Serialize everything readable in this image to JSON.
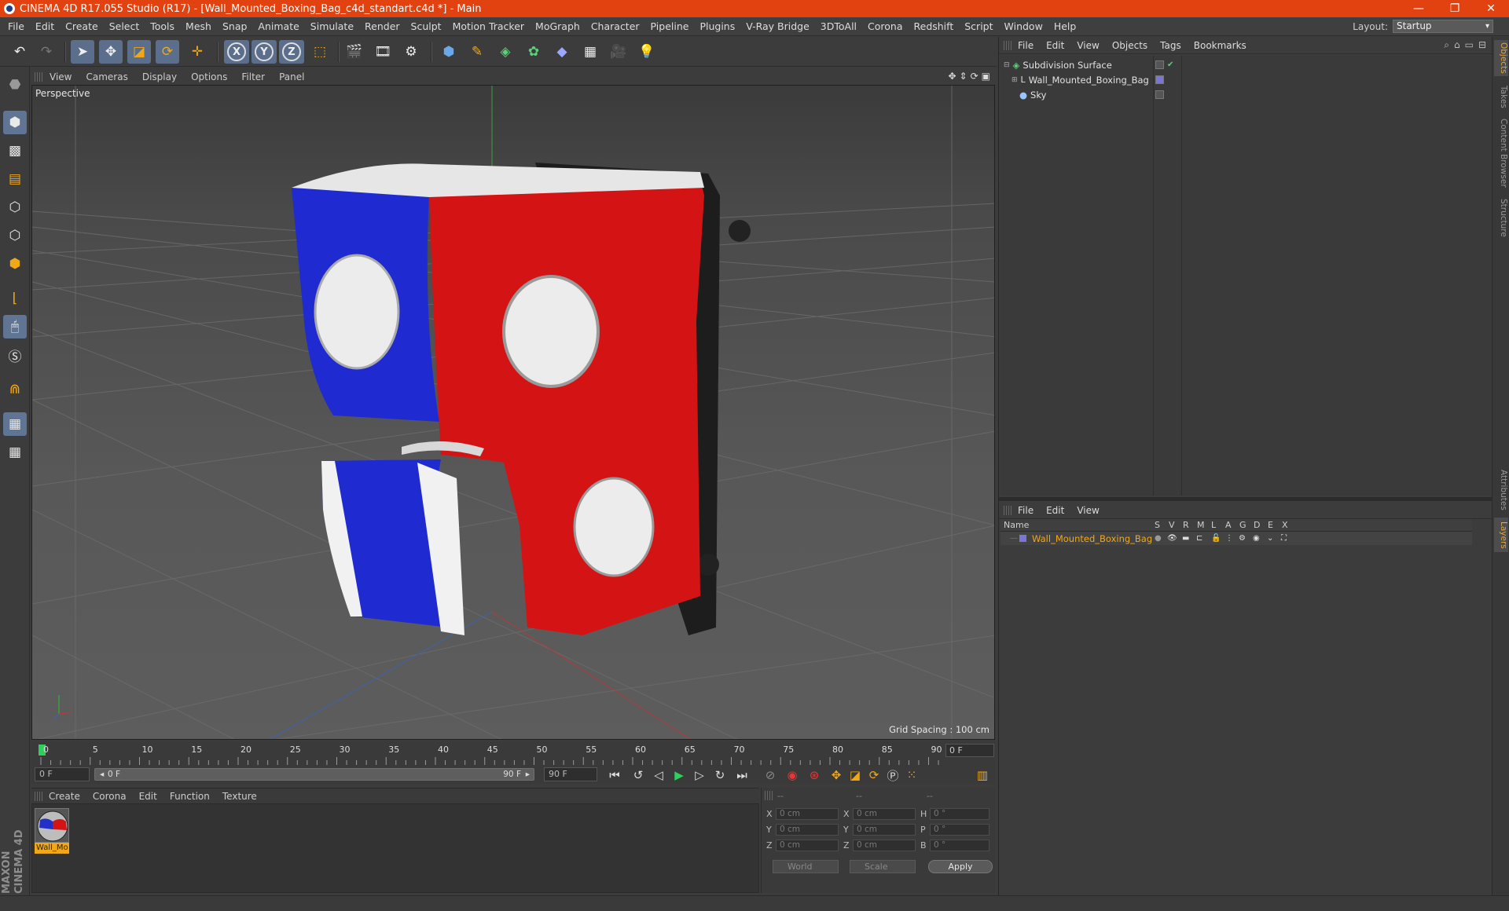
{
  "titlebar": {
    "title": "CINEMA 4D R17.055 Studio (R17) - [Wall_Mounted_Boxing_Bag_c4d_standart.c4d *] - Main"
  },
  "menubar": {
    "items": [
      "File",
      "Edit",
      "Create",
      "Select",
      "Tools",
      "Mesh",
      "Snap",
      "Animate",
      "Simulate",
      "Render",
      "Sculpt",
      "Motion Tracker",
      "MoGraph",
      "Character",
      "Pipeline",
      "Plugins",
      "V-Ray Bridge",
      "3DToAll",
      "Corona",
      "Redshift",
      "Script",
      "Window",
      "Help"
    ],
    "layout_label": "Layout:",
    "layout_value": "Startup"
  },
  "toolbar": {
    "x_label": "X",
    "y_label": "Y",
    "z_label": "Z"
  },
  "viewport": {
    "menu": [
      "View",
      "Cameras",
      "Display",
      "Options",
      "Filter",
      "Panel"
    ],
    "label": "Perspective",
    "grid_spacing": "Grid Spacing : 100 cm"
  },
  "timeline": {
    "ticks": [
      "0",
      "5",
      "10",
      "15",
      "20",
      "25",
      "30",
      "35",
      "40",
      "45",
      "50",
      "55",
      "60",
      "65",
      "70",
      "75",
      "80",
      "85",
      "90"
    ],
    "current_frame": "0 F",
    "start_frame": "0 F",
    "slider_start": "0 F",
    "slider_end": "90 F",
    "end_frame": "90 F"
  },
  "materials": {
    "menu": [
      "Create",
      "Corona",
      "Edit",
      "Function",
      "Texture"
    ],
    "items": [
      {
        "label": "Wall_Mo"
      }
    ]
  },
  "coords": {
    "header": [
      "--",
      "--",
      "--"
    ],
    "rows": [
      {
        "l1": "X",
        "v1": "0 cm",
        "l2": "X",
        "v2": "0 cm",
        "l3": "H",
        "v3": "0 °"
      },
      {
        "l1": "Y",
        "v1": "0 cm",
        "l2": "Y",
        "v2": "0 cm",
        "l3": "P",
        "v3": "0 °"
      },
      {
        "l1": "Z",
        "v1": "0 cm",
        "l2": "Z",
        "v2": "0 cm",
        "l3": "B",
        "v3": "0 °"
      }
    ],
    "mode": "World",
    "type": "Scale",
    "apply": "Apply"
  },
  "objects_panel": {
    "menu": [
      "File",
      "Edit",
      "View",
      "Objects",
      "Tags",
      "Bookmarks"
    ],
    "items": [
      {
        "name": "Subdivision Surface"
      },
      {
        "name": "Wall_Mounted_Boxing_Bag"
      },
      {
        "name": "Sky"
      }
    ]
  },
  "layers_panel": {
    "menu": [
      "File",
      "Edit",
      "View"
    ],
    "columns": [
      "Name",
      "S",
      "V",
      "R",
      "M",
      "L",
      "A",
      "G",
      "D",
      "E",
      "X"
    ],
    "rows": [
      {
        "name": "Wall_Mounted_Boxing_Bag"
      }
    ]
  },
  "side_tabs": [
    "Objects",
    "Takes",
    "Content Browser",
    "Structure",
    "Attributes",
    "Layers"
  ],
  "branding": "MAXON CINEMA 4D",
  "colors": {
    "title_bar": "#e1420f",
    "accent_orange": "#f0a818",
    "selection_blue": "#5b6f8c",
    "layer_name": "#f0a818"
  }
}
